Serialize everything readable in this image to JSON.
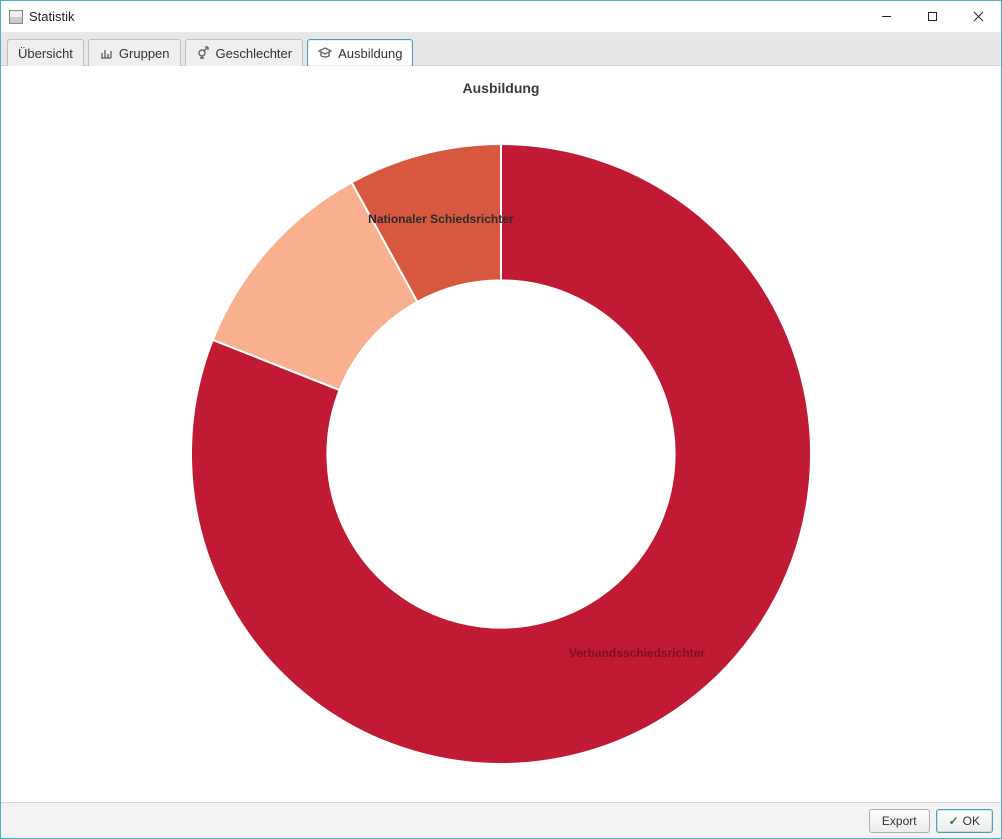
{
  "window": {
    "title": "Statistik"
  },
  "tabs": [
    {
      "label": "Übersicht"
    },
    {
      "label": "Gruppen"
    },
    {
      "label": "Geschlechter"
    },
    {
      "label": "Ausbildung"
    }
  ],
  "active_tab": 3,
  "chart": {
    "title": "Ausbildung"
  },
  "chart_data": {
    "type": "pie",
    "title": "Ausbildung",
    "slices": [
      {
        "name": "Verbandsschiedsrichter",
        "value": 81,
        "color": "#c01a34"
      },
      {
        "name": "",
        "value": 11,
        "color": "#f8b08e"
      },
      {
        "name": "Nationaler Schiedsrichter",
        "value": 8,
        "color": "#d7583f"
      }
    ],
    "donut_inner_ratio": 0.56
  },
  "footer": {
    "export_label": "Export",
    "ok_label": "OK"
  }
}
